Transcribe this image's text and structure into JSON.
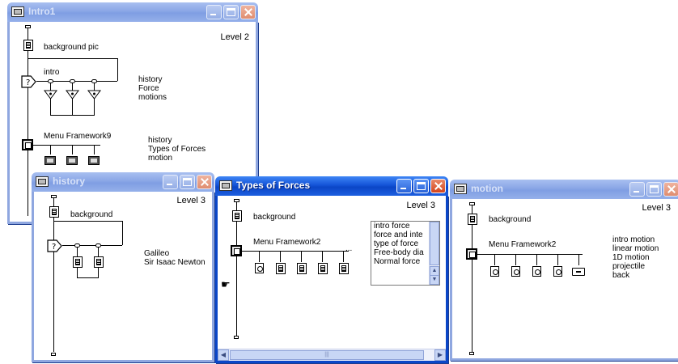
{
  "windows": {
    "intro1": {
      "title": "Intro1",
      "level": "Level 2",
      "background_label": "background pic",
      "decision_label": "intro",
      "decision_branches": [
        "history",
        "Force",
        "motions"
      ],
      "framework_label": "Menu Framework9",
      "framework_pages": [
        "history",
        "Types of Forces",
        "motion"
      ]
    },
    "history": {
      "title": "history",
      "level": "Level 3",
      "background_label": "background",
      "branches": [
        "Galileo",
        "Sir Isaac Newton"
      ]
    },
    "types_of_forces": {
      "title": "Types of Forces",
      "level": "Level 3",
      "background_label": "background",
      "framework_label": "Menu Framework2",
      "more_indicator": "...",
      "list_items": [
        "intro force",
        "force and inte",
        "type of force",
        "Free-body dia",
        "Normal force"
      ],
      "scroll_center_glyph": "|||"
    },
    "motion": {
      "title": "motion",
      "level": "Level 3",
      "background_label": "background",
      "framework_label": "Menu Framework2",
      "pages": [
        "intro motion",
        "linear motion",
        "1D motion",
        "projectile",
        "back"
      ]
    }
  },
  "icons": {
    "window_icon": "authorware-icon",
    "display": "display-icon",
    "framework": "framework-icon",
    "decision": "decision-icon",
    "map": "map-icon",
    "hand_cursor": "paste-hand-icon"
  },
  "colors": {
    "titlebar_active": "#1454d8",
    "titlebar_inactive": "#8aa6e6",
    "close_button": "#d4441c",
    "window_frame": "#3b6fd6"
  }
}
